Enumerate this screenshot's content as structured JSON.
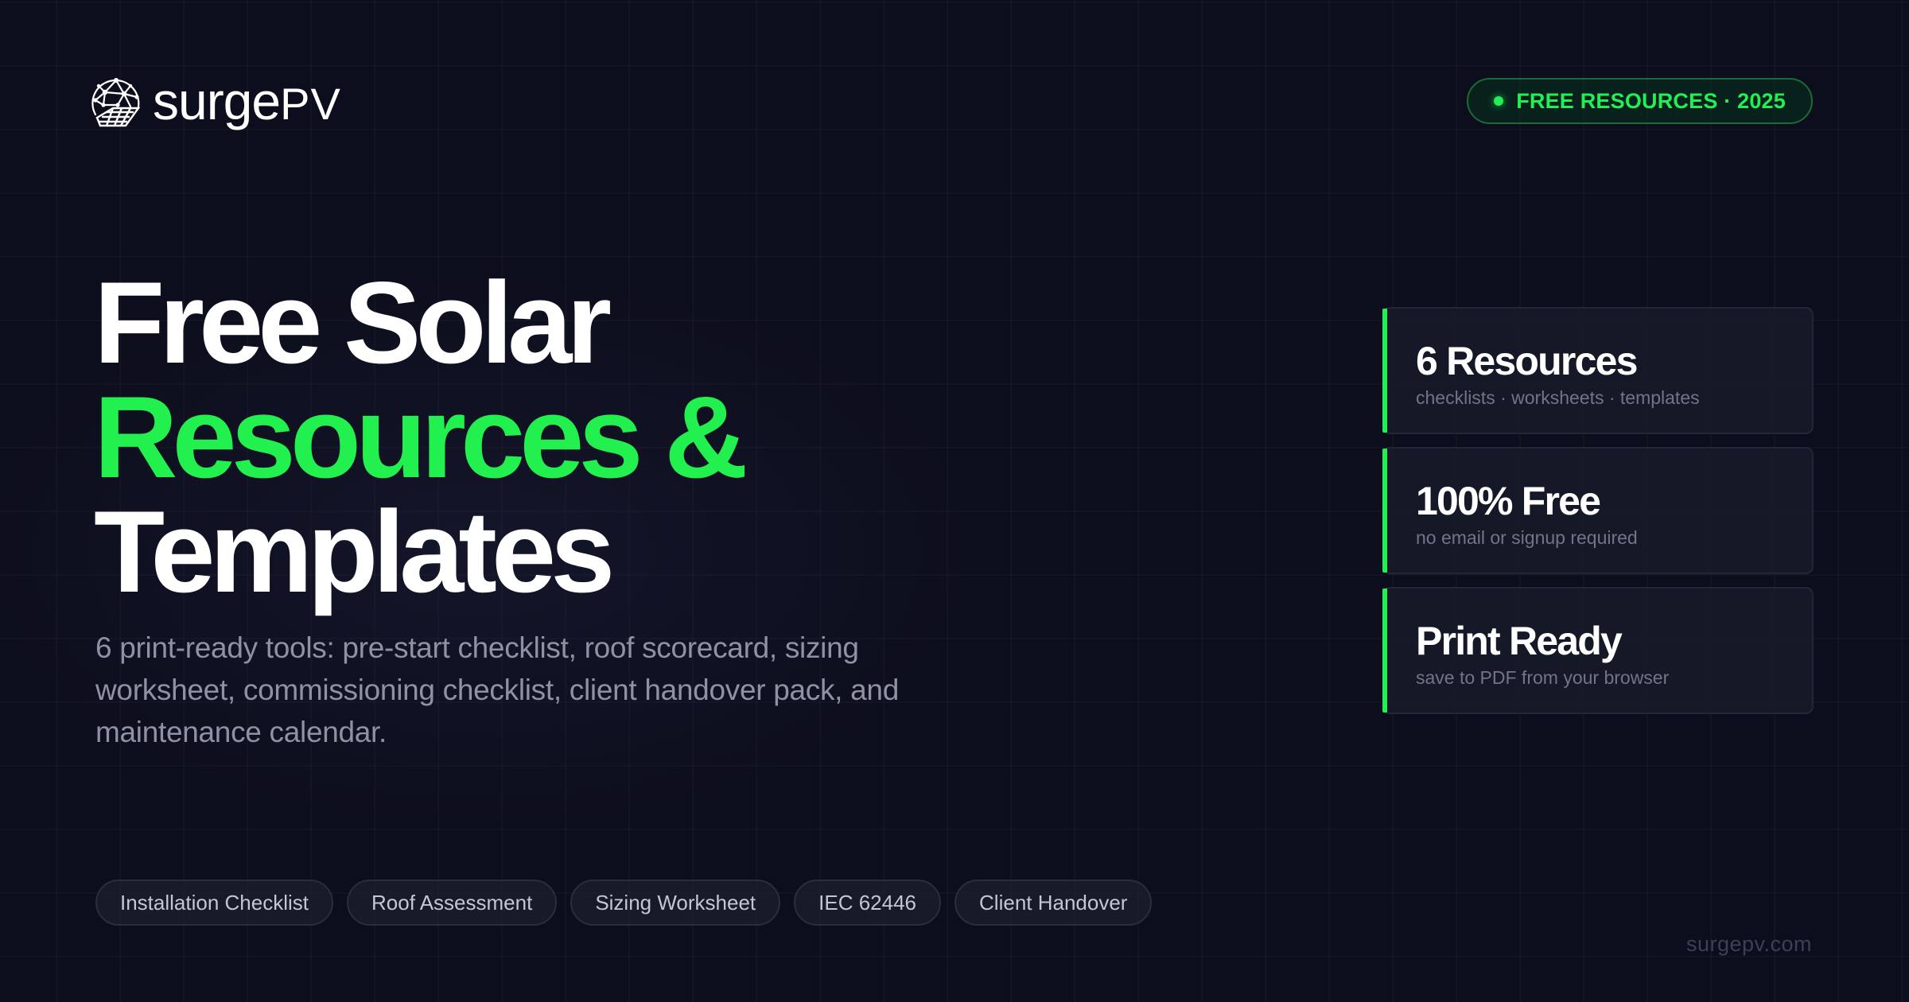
{
  "brand": {
    "logo_text": "surge",
    "logo_text_suffix": "PV",
    "logo_icon": "globe-solar-panel-icon"
  },
  "top_badge": {
    "label": "FREE RESOURCES · 2025",
    "icon": "status-dot-icon",
    "color": "#22ee55"
  },
  "headline": {
    "line1": "Free Solar",
    "line2": "Resources &",
    "line3": "Templates",
    "accent_color": "#22f04f"
  },
  "subtext": "6 print-ready tools: pre-start checklist, roof scorecard, sizing worksheet, commissioning checklist, client handover pack, and maintenance calendar.",
  "stats": [
    {
      "value": "6 Resources",
      "caption": "checklists · worksheets · templates"
    },
    {
      "value": "100% Free",
      "caption": "no email or signup required"
    },
    {
      "value": "Print Ready",
      "caption": "save to PDF from your browser"
    }
  ],
  "tags": [
    "Installation Checklist",
    "Roof Assessment",
    "Sizing Worksheet",
    "IEC 62446",
    "Client Handover"
  ],
  "footer": {
    "url": "surgepv.com"
  },
  "colors": {
    "background": "#0d0e1d",
    "accent_green": "#22ee55",
    "muted_text": "#8f92a3"
  }
}
